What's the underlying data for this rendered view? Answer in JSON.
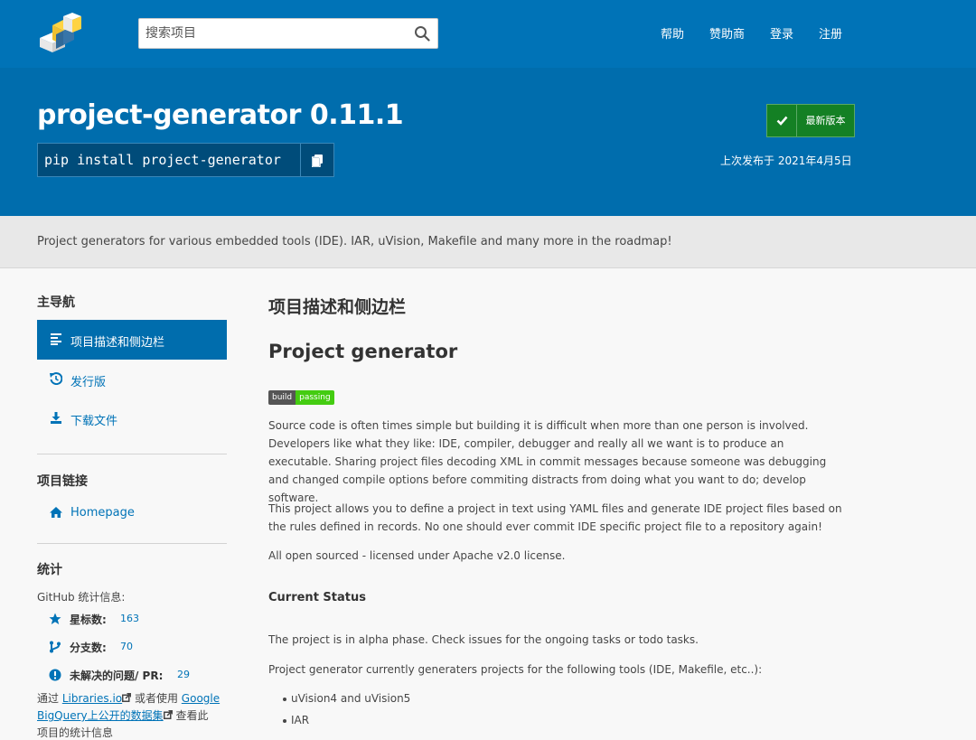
{
  "header": {
    "search_placeholder": "搜索项目",
    "nav": [
      "帮助",
      "赞助商",
      "登录",
      "注册"
    ]
  },
  "banner": {
    "title": "project-generator 0.11.1",
    "pip_command": "pip install project-generator",
    "latest_label": "最新版本",
    "released": "上次发布于 2021年4月5日"
  },
  "summary": "Project generators for various embedded tools (IDE). IAR, uVision, Makefile and many more in the roadmap!",
  "sidebar": {
    "nav_heading": "主导航",
    "nav_items": [
      {
        "label": "项目描述和侧边栏",
        "icon": "align-left-icon"
      },
      {
        "label": "发行版",
        "icon": "history-icon"
      },
      {
        "label": "下载文件",
        "icon": "download-icon"
      }
    ],
    "links_heading": "项目链接",
    "homepage": "Homepage",
    "stats_heading": "统计",
    "github_stats": "GitHub 统计信息:",
    "stars_label": "星标数:",
    "stars_value": "163",
    "forks_label": "分支数:",
    "forks_value": "70",
    "issues_label": "未解决的问题/ PR:",
    "issues_value": "29",
    "via_prefix": "通过 ",
    "libraries_link": "Libraries.io",
    "or_use": " 或者使用 ",
    "bigquery_link_1": "Google",
    "bigquery_link_2": "BigQuery上公开的数据集",
    "view_this": " 查看此",
    "project_stats": "项目的统计信息"
  },
  "main": {
    "section_title": "项目描述和侧边栏",
    "heading": "Project generator",
    "badge_left": "build",
    "badge_right": "passing",
    "p1": "Source code is often times simple but building it is difficult when more than one person is involved. Developers like what they like: IDE, compiler, debugger and really all we want is to produce an executable. Sharing project files decoding XML in commit messages because someone was debugging and changed compile options before commiting distracts from doing what you want to do; develop software.",
    "p2": "This project allows you to define a project in text using YAML files and generate IDE project files based on the rules defined in records. No one should ever commit IDE specific project file to a repository again!",
    "p3": "All open sourced - licensed under Apache v2.0 license.",
    "status_heading": "Current Status",
    "p4": "The project is in alpha phase. Check issues for the ongoing tasks or todo tasks.",
    "p5": "Project generator currently generaters projects for the following tools (IDE, Makefile, etc..):",
    "tools": [
      "uVision4 and uVision5",
      "IAR"
    ]
  },
  "colors": {
    "header_blue": "#0073b7",
    "banner_blue": "#006dad",
    "green": "#148024"
  }
}
